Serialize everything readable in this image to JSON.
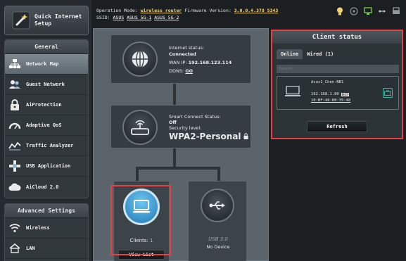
{
  "sidebar": {
    "quick_setup": "Quick Internet Setup",
    "general_header": "General",
    "general_items": [
      {
        "label": "Network Map",
        "icon": "network-map-icon"
      },
      {
        "label": "Guest Network",
        "icon": "guest-network-icon"
      },
      {
        "label": "AiProtection",
        "icon": "lock-icon"
      },
      {
        "label": "Adaptive QoS",
        "icon": "speedometer-icon"
      },
      {
        "label": "Traffic Analyzer",
        "icon": "traffic-analyzer-icon"
      },
      {
        "label": "USB Application",
        "icon": "usb-application-icon"
      },
      {
        "label": "AiCloud 2.0",
        "icon": "cloud-icon"
      }
    ],
    "advanced_header": "Advanced Settings",
    "advanced_items": [
      {
        "label": "Wireless",
        "icon": "wifi-icon"
      },
      {
        "label": "LAN",
        "icon": "home-icon"
      }
    ]
  },
  "header": {
    "op_mode_label": "Operation Mode:",
    "op_mode_value": "wireless router",
    "fw_label": "Firmware Version:",
    "fw_value": "3.0.0.4.378_5343",
    "ssid_label": "SSID:",
    "ssid_1": "ASUS",
    "ssid_2": "ASUS_5G-1",
    "ssid_3": "ASUS_5G-2"
  },
  "map": {
    "internet_status_label": "Internet status:",
    "internet_status_value": "Connected",
    "wan_ip_label": "WAN IP:",
    "wan_ip_value": "192.168.123.114",
    "ddns_label": "DDNS:",
    "ddns_value": "GO",
    "smart_connect_label": "Smart Connect Status:",
    "smart_connect_value": "Off",
    "security_label": "Security level:",
    "security_value": "WPA2-Personal",
    "clients_label": "Clients:",
    "clients_count": "1",
    "view_list": "View List",
    "usb_label": "USB 3.0",
    "usb_status": "No Device"
  },
  "client_status": {
    "title": "Client status",
    "tab_online": "Online",
    "tab_wired": "Wired (1)",
    "search_placeholder": "Search",
    "client": {
      "name": "Asus1_Chen-NB1",
      "ip": "192.168.1.80",
      "ip_tag": "DHCP",
      "mac": "10:BF:48:8B:35:48"
    },
    "refresh": "Refresh"
  },
  "colors": {
    "highlight_red": "#e64040",
    "header_link": "#f2d36b",
    "client_count": "#5fc3f0",
    "icon_teal": "#35b9a6"
  }
}
